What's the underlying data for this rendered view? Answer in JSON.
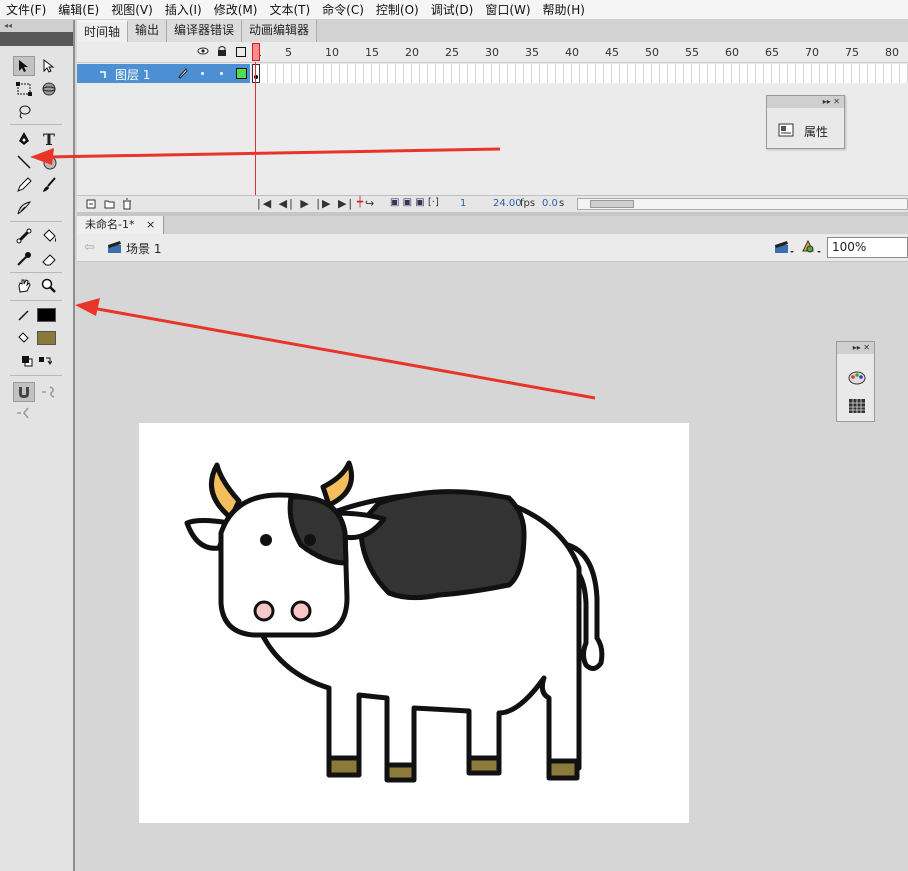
{
  "menu": [
    "文件(F)",
    "编辑(E)",
    "视图(V)",
    "插入(I)",
    "修改(M)",
    "文本(T)",
    "命令(C)",
    "控制(O)",
    "调试(D)",
    "窗口(W)",
    "帮助(H)"
  ],
  "panel_tabs": [
    "时间轴",
    "输出",
    "编译器错误",
    "动画编辑器"
  ],
  "toolbox": {
    "collapse_glyph": "◂◂",
    "tools": [
      "selection-tool",
      "subselection-tool",
      "free-transform-tool",
      "3d-rotation-tool",
      "lasso-tool",
      "pen-tool",
      "text-tool",
      "line-tool",
      "rectangle-tool",
      "pencil-tool",
      "brush-tool",
      "deco-tool",
      "bone-tool",
      "paint-bucket-tool",
      "eyedropper-tool",
      "eraser-tool",
      "hand-tool",
      "zoom-tool",
      "stroke-color",
      "fill-color",
      "black-white",
      "swap-colors",
      "snap-to-objects",
      "smooth",
      "straighten"
    ],
    "stroke_color": "#000000",
    "fill_color": "#8a7a3a"
  },
  "timeline": {
    "layer_name": "图层 1",
    "ruler": [
      "1",
      "5",
      "10",
      "15",
      "20",
      "25",
      "30",
      "35",
      "40",
      "45",
      "50",
      "55",
      "60",
      "65",
      "70",
      "75",
      "80"
    ],
    "current_frame": "1",
    "fps": "24.00",
    "fps_unit": "fps",
    "time": "0.0",
    "time_unit": "s"
  },
  "props_panel": {
    "label": "属性",
    "head_glyph": "▸▸ ✕"
  },
  "document": {
    "tab": "未命名-1*",
    "tab_close": "×",
    "scene": "场景 1",
    "zoom": "100%"
  },
  "small_panel": {
    "head_glyph": "▸▸ ✕"
  },
  "colors": {
    "layer_highlight": "#4d8fd3",
    "arrow": "#e8352a",
    "cow_patch": "#333333",
    "horn": "#f4be5e",
    "hoof": "#8c7a3a",
    "nose": "#f7c6c6"
  }
}
